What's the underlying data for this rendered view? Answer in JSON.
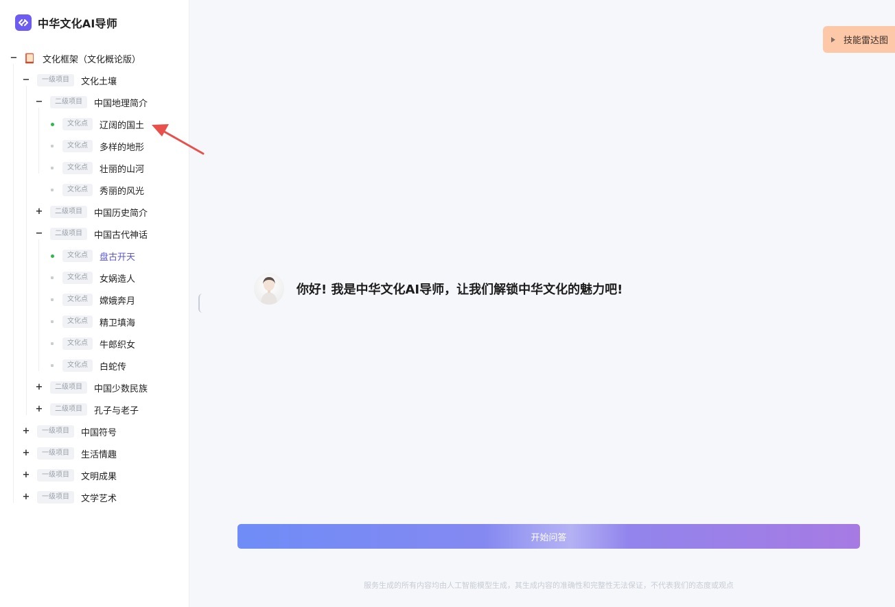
{
  "brand": {
    "title": "中华文化AI导师"
  },
  "tree": {
    "root": {
      "label": "文化框架（文化概论版）"
    },
    "rows": [
      {
        "level": 1,
        "toggle": "−",
        "tag": "一级项目",
        "label": "文化土壤"
      },
      {
        "level": 2,
        "toggle": "−",
        "tag": "二级项目",
        "label": "中国地理简介"
      },
      {
        "level": 3,
        "dot": "green",
        "tag": "文化点",
        "label": "辽阔的国土"
      },
      {
        "level": 3,
        "dot": "grey",
        "tag": "文化点",
        "label": "多样的地形"
      },
      {
        "level": 3,
        "dot": "grey",
        "tag": "文化点",
        "label": "壮丽的山河"
      },
      {
        "level": 3,
        "dot": "grey",
        "tag": "文化点",
        "label": "秀丽的风光"
      },
      {
        "level": 2,
        "toggle": "+",
        "tag": "二级项目",
        "label": "中国历史简介"
      },
      {
        "level": 2,
        "toggle": "−",
        "tag": "二级项目",
        "label": "中国古代神话"
      },
      {
        "level": 3,
        "dot": "green",
        "tag": "文化点",
        "label": "盘古开天",
        "active": true
      },
      {
        "level": 3,
        "dot": "grey",
        "tag": "文化点",
        "label": "女娲造人"
      },
      {
        "level": 3,
        "dot": "grey",
        "tag": "文化点",
        "label": "嫦娥奔月"
      },
      {
        "level": 3,
        "dot": "grey",
        "tag": "文化点",
        "label": "精卫填海"
      },
      {
        "level": 3,
        "dot": "grey",
        "tag": "文化点",
        "label": "牛郎织女"
      },
      {
        "level": 3,
        "dot": "grey",
        "tag": "文化点",
        "label": "白蛇传"
      },
      {
        "level": 2,
        "toggle": "+",
        "tag": "二级项目",
        "label": "中国少数民族"
      },
      {
        "level": 2,
        "toggle": "+",
        "tag": "二级项目",
        "label": "孔子与老子"
      },
      {
        "level": 1,
        "toggle": "+",
        "tag": "一级项目",
        "label": "中国符号"
      },
      {
        "level": 1,
        "toggle": "+",
        "tag": "一级项目",
        "label": "生活情趣"
      },
      {
        "level": 1,
        "toggle": "+",
        "tag": "一级项目",
        "label": "文明成果"
      },
      {
        "level": 1,
        "toggle": "+",
        "tag": "一级项目",
        "label": "文学艺术"
      }
    ]
  },
  "radar_button": {
    "label": "技能雷达图"
  },
  "chat": {
    "greeting": "你好! 我是中华文化AI导师，让我们解锁中华文化的魅力吧!"
  },
  "start_button": {
    "label": "开始问答"
  },
  "footer": {
    "disclaimer": "服务生成的所有内容均由人工智能模型生成，其生成内容的准确性和完整性无法保证，不代表我们的态度或观点"
  },
  "colors": {
    "accent": "#5a56d6",
    "brand": "#6d5cf2",
    "active_dot": "#2db84d",
    "radar_bg": "#fdc8a8",
    "arrow": "#e8504b"
  }
}
